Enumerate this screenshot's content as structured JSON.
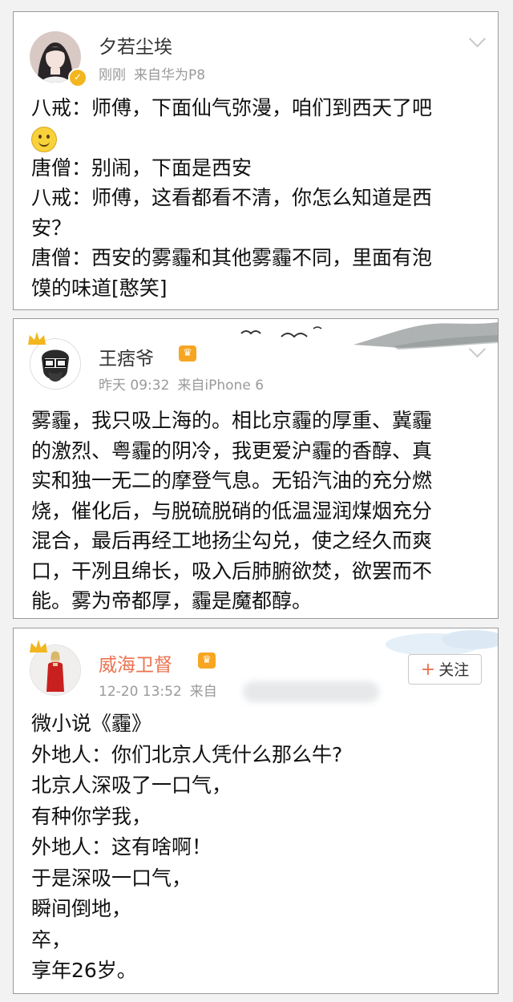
{
  "posts": [
    {
      "username": "夕若尘埃",
      "time": "刚刚",
      "source": "来自华为P8",
      "lines": [
        "八戒：师傅，下面仙气弥漫，咱们到西天了吧",
        "唐僧：别闹，下面是西安",
        "八戒：师傅，这看都看不清，你怎么知道是西",
        "安？",
        "唐僧：西安的雾霾和其他雾霾不同，里面有泡",
        "馍的味道[憨笑]"
      ]
    },
    {
      "username": "王痞爷",
      "time": "昨天 09:32",
      "source": "来自iPhone 6",
      "lines": [
        "雾霾，我只吸上海的。相比京霾的厚重、冀霾",
        "的激烈、粤霾的阴冷，我更爱沪霾的香醇、真",
        "实和独一无二的摩登气息。无铅汽油的充分燃",
        "烧，催化后，与脱硫脱硝的低温湿润煤烟充分",
        "混合，最后再经工地扬尘勾兑，使之经久而爽",
        "口，干冽且绵长，吸入后肺腑欲焚，欲罢而不",
        "能。雾为帝都厚，霾是魔都醇。"
      ]
    },
    {
      "username": "威海卫督",
      "time": "12-20 13:52",
      "source": "来自",
      "follow_label": "关注",
      "lines": [
        "微小说《霾》",
        "外地人：你们北京人凭什么那么牛?",
        "北京人深吸了一口气，",
        "有种你学我，",
        "外地人：这有啥啊！",
        "于是深吸一口气，",
        "瞬间倒地，",
        "卒，",
        "享年26岁。"
      ]
    }
  ],
  "icons": {
    "smiley": "smile-emoji-icon",
    "vip_badge": "vip-crown-badge-icon",
    "chevron": "chevron-down-icon"
  }
}
